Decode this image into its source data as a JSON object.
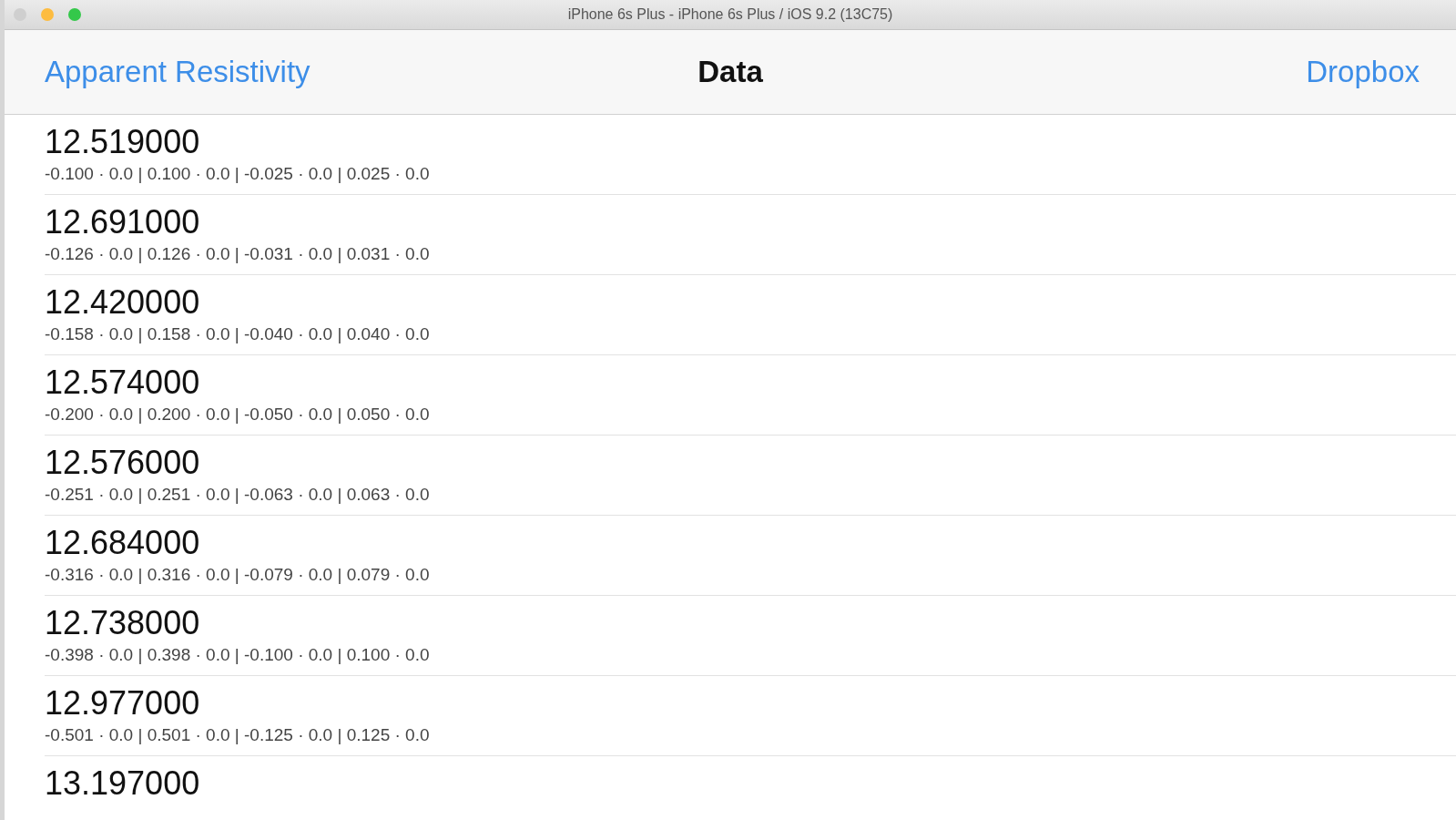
{
  "window": {
    "title": "iPhone 6s Plus - iPhone 6s Plus / iOS 9.2 (13C75)",
    "controls": [
      {
        "kind": "close",
        "disabled": true
      },
      {
        "kind": "minimize",
        "disabled": false
      },
      {
        "kind": "zoom",
        "disabled": false
      }
    ]
  },
  "nav_bar": {
    "back": "Apparent Resistivity",
    "title": "Data",
    "action": "Dropbox"
  },
  "rows": [
    {
      "value": "12.519000",
      "detail": "-0.100 · 0.0 | 0.100 · 0.0 | -0.025 · 0.0 | 0.025 · 0.0"
    },
    {
      "value": "12.691000",
      "detail": "-0.126 · 0.0 | 0.126 · 0.0 | -0.031 · 0.0 | 0.031 · 0.0"
    },
    {
      "value": "12.420000",
      "detail": "-0.158 · 0.0 | 0.158 · 0.0 | -0.040 · 0.0 | 0.040 · 0.0"
    },
    {
      "value": "12.574000",
      "detail": "-0.200 · 0.0 | 0.200 · 0.0 | -0.050 · 0.0 | 0.050 · 0.0"
    },
    {
      "value": "12.576000",
      "detail": "-0.251 · 0.0 | 0.251 · 0.0 | -0.063 · 0.0 | 0.063 · 0.0"
    },
    {
      "value": "12.684000",
      "detail": "-0.316 · 0.0 | 0.316 · 0.0 | -0.079 · 0.0 | 0.079 · 0.0"
    },
    {
      "value": "12.738000",
      "detail": "-0.398 · 0.0 | 0.398 · 0.0 | -0.100 · 0.0 | 0.100 · 0.0"
    },
    {
      "value": "12.977000",
      "detail": "-0.501 · 0.0 | 0.501 · 0.0 | -0.125 · 0.0 | 0.125 · 0.0"
    },
    {
      "value": "13.197000"
    }
  ]
}
